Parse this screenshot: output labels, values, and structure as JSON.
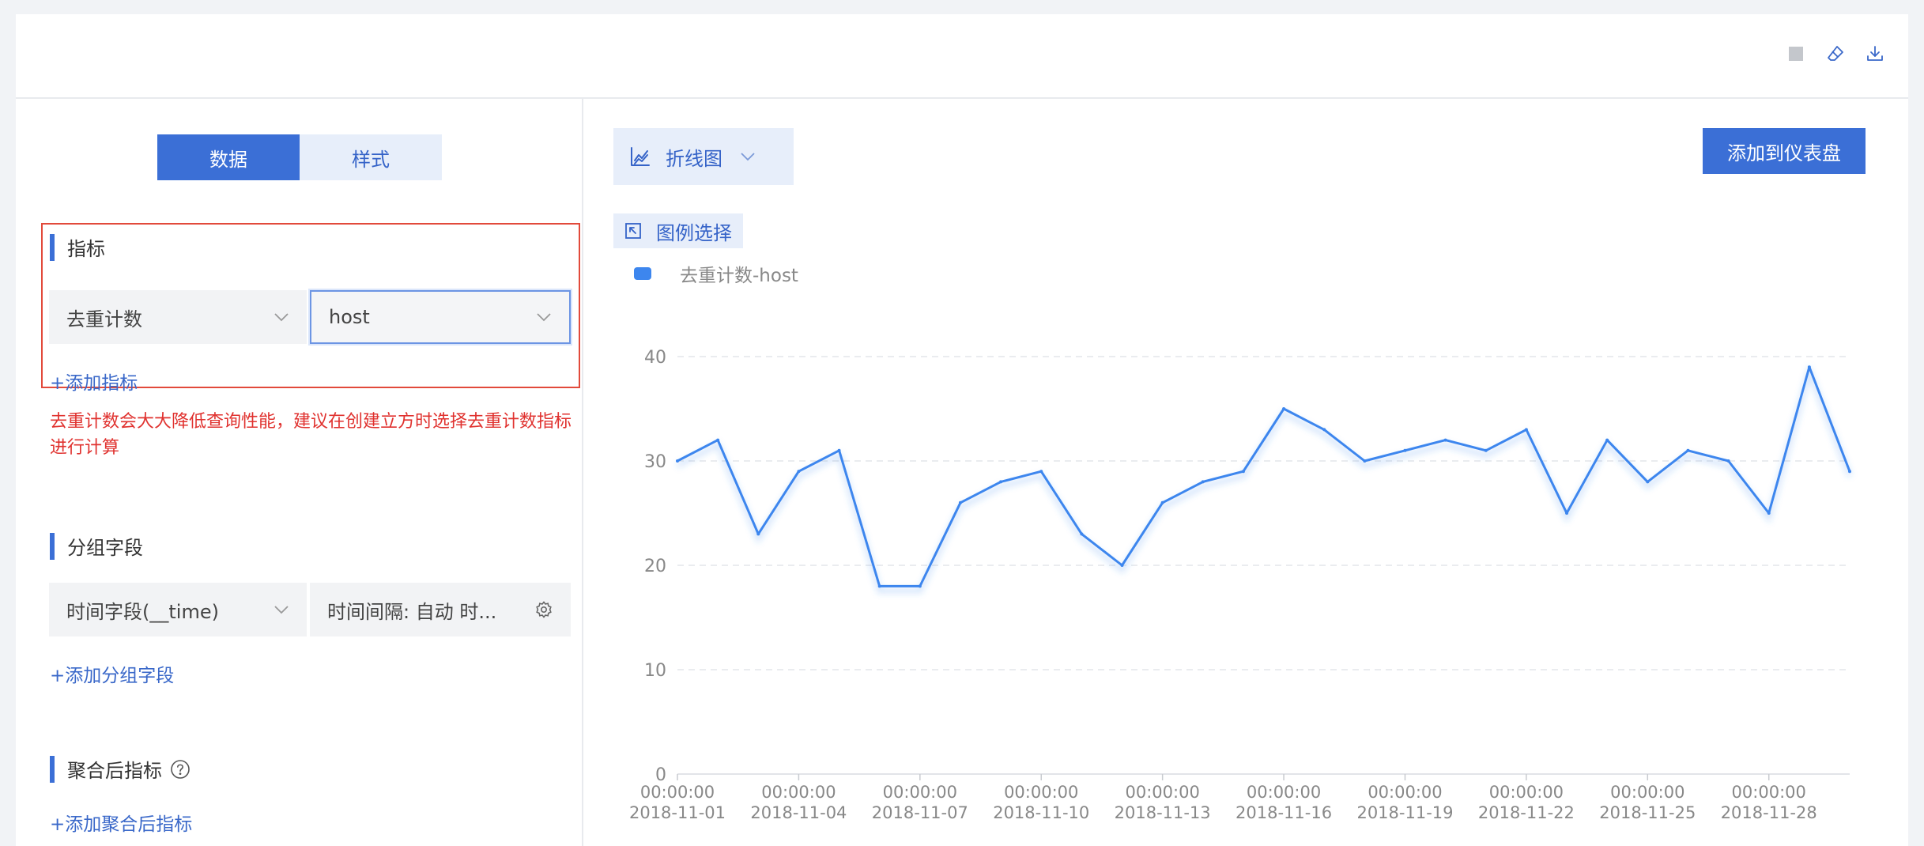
{
  "toolbar": {
    "icons": [
      "stop-icon",
      "eraser-icon",
      "download-icon"
    ]
  },
  "left_panel": {
    "tabs": [
      {
        "label": "数据",
        "active": true
      },
      {
        "label": "样式",
        "active": false
      }
    ],
    "metrics": {
      "title": "指标",
      "aggregation": "去重计数",
      "field": "host",
      "add_label": "+添加指标",
      "warning": "去重计数会大大降低查询性能，建议在创建立方时选择去重计数指标进行计算"
    },
    "group": {
      "title": "分组字段",
      "field": "时间字段(__time)",
      "interval": "时间间隔: 自动 时...",
      "add_label": "+添加分组字段"
    },
    "post_agg": {
      "title": "聚合后指标",
      "add_label": "+添加聚合后指标"
    }
  },
  "right_panel": {
    "chart_type": "折线图",
    "add_dashboard": "添加到仪表盘",
    "legend_select": "图例选择"
  },
  "colors": {
    "primary": "#3b6fd6",
    "line": "#3d86ee",
    "warning": "#e0322f"
  },
  "chart_data": {
    "type": "line",
    "ylim": [
      0,
      40
    ],
    "yticks": [
      0,
      10,
      20,
      30,
      40
    ],
    "grid": true,
    "legend_position": "top-left",
    "x_tick_labels": [
      [
        "00:00:00",
        "2018-11-01"
      ],
      [
        "00:00:00",
        "2018-11-04"
      ],
      [
        "00:00:00",
        "2018-11-07"
      ],
      [
        "00:00:00",
        "2018-11-10"
      ],
      [
        "00:00:00",
        "2018-11-13"
      ],
      [
        "00:00:00",
        "2018-11-16"
      ],
      [
        "00:00:00",
        "2018-11-19"
      ],
      [
        "00:00:00",
        "2018-11-22"
      ],
      [
        "00:00:00",
        "2018-11-25"
      ],
      [
        "00:00:00",
        "2018-11-28"
      ]
    ],
    "x": [
      "2018-11-01",
      "2018-11-02",
      "2018-11-03",
      "2018-11-04",
      "2018-11-05",
      "2018-11-06",
      "2018-11-07",
      "2018-11-08",
      "2018-11-09",
      "2018-11-10",
      "2018-11-11",
      "2018-11-12",
      "2018-11-13",
      "2018-11-14",
      "2018-11-15",
      "2018-11-16",
      "2018-11-17",
      "2018-11-18",
      "2018-11-19",
      "2018-11-20",
      "2018-11-21",
      "2018-11-22",
      "2018-11-23",
      "2018-11-24",
      "2018-11-25",
      "2018-11-26",
      "2018-11-27",
      "2018-11-28",
      "2018-11-29",
      "2018-11-30"
    ],
    "series": [
      {
        "name": "去重计数-host",
        "values": [
          30,
          32,
          23,
          29,
          31,
          18,
          18,
          26,
          28,
          29,
          23,
          20,
          26,
          28,
          29,
          35,
          33,
          30,
          31,
          32,
          31,
          33,
          25,
          32,
          28,
          31,
          30,
          25,
          39,
          29
        ]
      }
    ]
  }
}
